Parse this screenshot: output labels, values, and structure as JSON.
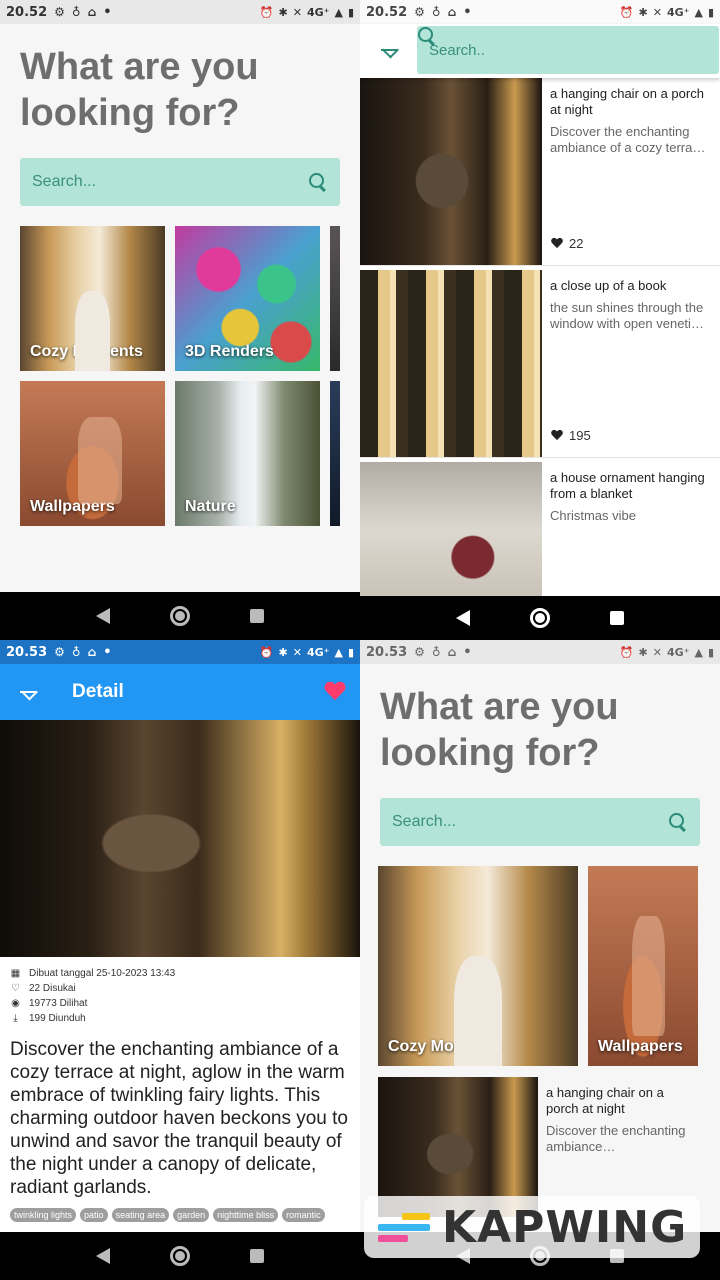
{
  "status": {
    "q1_time": "20.52",
    "q2_time": "20.52",
    "q3_time": "20.53",
    "q4_time": "20.53",
    "network": "4G⁺"
  },
  "home": {
    "heading": "What are you looking for?",
    "search_placeholder": "Search...",
    "categories": [
      {
        "label": "Cozy Moments"
      },
      {
        "label": "3D Renders"
      },
      {
        "label": "Wallpapers"
      },
      {
        "label": "Nature"
      }
    ]
  },
  "search_screen": {
    "search_placeholder": "Search..",
    "results": [
      {
        "title": "a hanging chair on a porch at night",
        "description": "Discover the enchanting ambiance of a cozy terra…",
        "likes": "22"
      },
      {
        "title": "a close up of a book",
        "description": "the sun shines through the window with open veneti…",
        "likes": "195"
      },
      {
        "title": "a house ornament hanging from a blanket",
        "description": "Christmas vibe",
        "likes": ""
      }
    ]
  },
  "detail": {
    "title": "Detail",
    "created": "Dibuat tanggal 25-10-2023 13:43",
    "liked": "22 Disukai",
    "views": "19773 Dilihat",
    "downloads": "199 Diunduh",
    "description": "Discover the enchanting ambiance of a cozy terrace at night, aglow in the warm embrace of twinkling fairy lights. This charming outdoor haven beckons you to unwind and savor the tranquil beauty of the night under a canopy of delicate, radiant garlands.",
    "tags": [
      "twinkling lights",
      "patio",
      "seating area",
      "garden",
      "nighttime bliss",
      "romantic"
    ]
  },
  "home2": {
    "heading": "What are you looking for?",
    "search_placeholder": "Search...",
    "categories": [
      {
        "label": "Cozy Moments"
      },
      {
        "label": "Wallpapers"
      }
    ],
    "result": {
      "title": "a hanging chair on a porch at night",
      "description": "Discover the enchanting ambiance…"
    }
  },
  "watermark": "KAPWING",
  "colors": {
    "search_bg": "#b2e4d8",
    "accent_teal": "#2a8b78",
    "appbar_blue": "#2196f3",
    "heart_pink": "#ff3b6b"
  }
}
